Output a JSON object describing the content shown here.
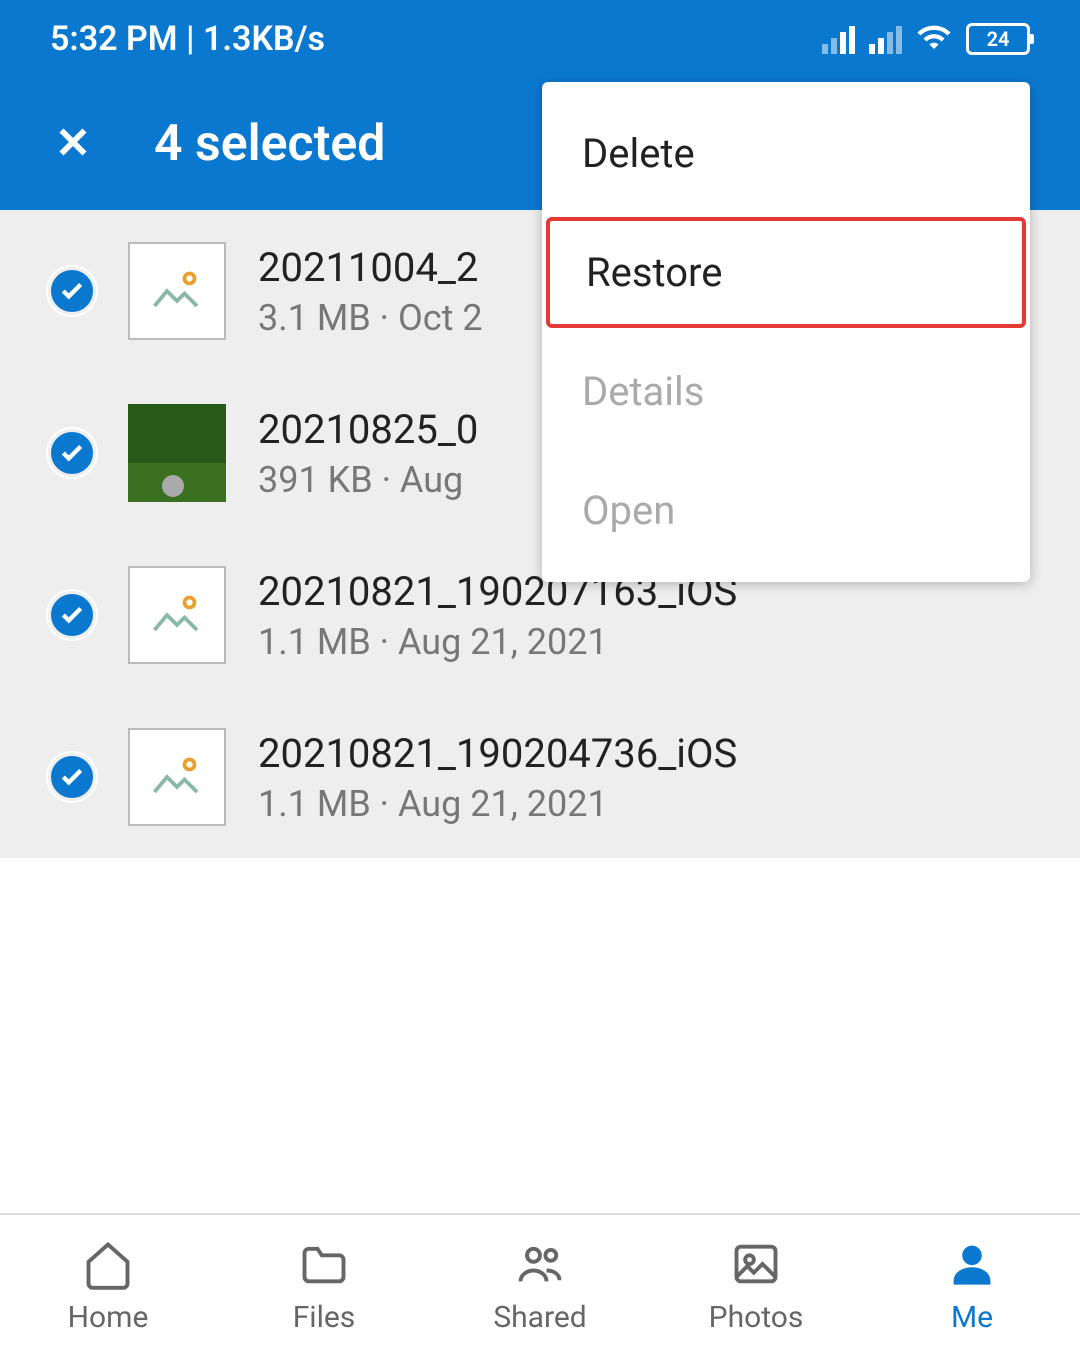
{
  "status_bar": {
    "time_text": "5:32 PM | 1.3KB/s",
    "battery_level": "24"
  },
  "header": {
    "title": "4 selected"
  },
  "files": [
    {
      "name": "20211004_2",
      "meta": "3.1 MB · Oct 2",
      "thumb": "placeholder"
    },
    {
      "name": "20210825_0",
      "meta": "391 KB · Aug",
      "thumb": "photo"
    },
    {
      "name": "20210821_190207163_iOS",
      "meta": "1.1 MB · Aug 21, 2021",
      "thumb": "placeholder"
    },
    {
      "name": "20210821_190204736_iOS",
      "meta": "1.1 MB · Aug 21, 2021",
      "thumb": "placeholder"
    }
  ],
  "menu": {
    "delete": "Delete",
    "restore": "Restore",
    "details": "Details",
    "open": "Open"
  },
  "nav": {
    "home": "Home",
    "files": "Files",
    "shared": "Shared",
    "photos": "Photos",
    "me": "Me"
  }
}
